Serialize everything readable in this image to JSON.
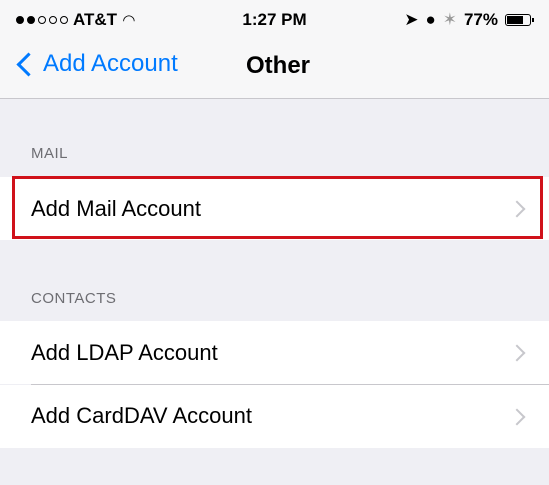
{
  "status_bar": {
    "carrier": "AT&T",
    "time": "1:27 PM",
    "battery_pct": "77%",
    "battery_level": 0.77,
    "signal_bars": [
      true,
      true,
      false,
      false,
      false
    ]
  },
  "nav": {
    "back_label": "Add Account",
    "title": "Other"
  },
  "sections": {
    "mail": {
      "header": "MAIL",
      "items": [
        {
          "label": "Add Mail Account"
        }
      ]
    },
    "contacts": {
      "header": "CONTACTS",
      "items": [
        {
          "label": "Add LDAP Account"
        },
        {
          "label": "Add CardDAV Account"
        }
      ]
    }
  },
  "colors": {
    "accent": "#007aff",
    "highlight": "#d0111a",
    "background": "#efeff4"
  }
}
